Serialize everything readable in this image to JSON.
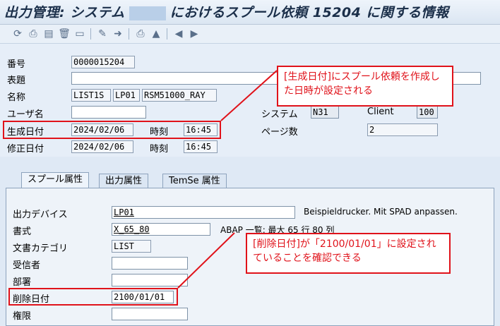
{
  "window": {
    "title_prefix": "出力管理: システム",
    "title_suffix": "におけるスプール依頼 15204 に関する情報"
  },
  "toolbar": {
    "icons": [
      "refresh-icon",
      "print-icon",
      "print-settings-icon",
      "delete-icon",
      "print-preview-icon",
      "edit-icon",
      "forward-icon",
      "printer-icon",
      "spool-status-icon",
      "previous-icon",
      "next-icon"
    ]
  },
  "header": {
    "number_label": "番号",
    "number_value": "0000015204",
    "title_label": "表題",
    "title_value": "",
    "name_label": "名称",
    "name_values": [
      "LIST1S",
      "LP01",
      "RSM51000_RAY"
    ],
    "user_label": "ユーザ名",
    "user_value": "",
    "created_label": "生成日付",
    "created_date": "2024/02/06",
    "created_time_label": "時刻",
    "created_time": "16:45",
    "modified_label": "修正日付",
    "modified_date": "2024/02/06",
    "modified_time_label": "時刻",
    "modified_time": "16:45",
    "system_label": "システム",
    "system_value": "N31",
    "client_label": "Client",
    "client_value": "100",
    "pages_label": "ページ数",
    "pages_value": "2"
  },
  "tabs": [
    "スプール属性",
    "出力属性",
    "TemSe 属性"
  ],
  "spool": {
    "device_label": "出力デバイス",
    "device_value": "LP01",
    "device_desc": "Beispieldrucker. Mit SPAD anpassen.",
    "format_label": "書式",
    "format_value": "X_65_80",
    "format_desc": "ABAP 一覧: 最大 65 行 80 列",
    "doctype_label": "文書カテゴリ",
    "doctype_value": "LIST",
    "recipient_label": "受信者",
    "recipient_value": "",
    "department_label": "部署",
    "department_value": "",
    "deletion_label": "削除日付",
    "deletion_value": "2100/01/01",
    "auth_label": "権限",
    "auth_value": ""
  },
  "annotations": {
    "callout1": "[生成日付]にスプール依頼を作成した日時が設定される",
    "callout2": "[削除日付]が「2100/01/01」に設定されていることを確認できる",
    "color": "#e0121a"
  }
}
